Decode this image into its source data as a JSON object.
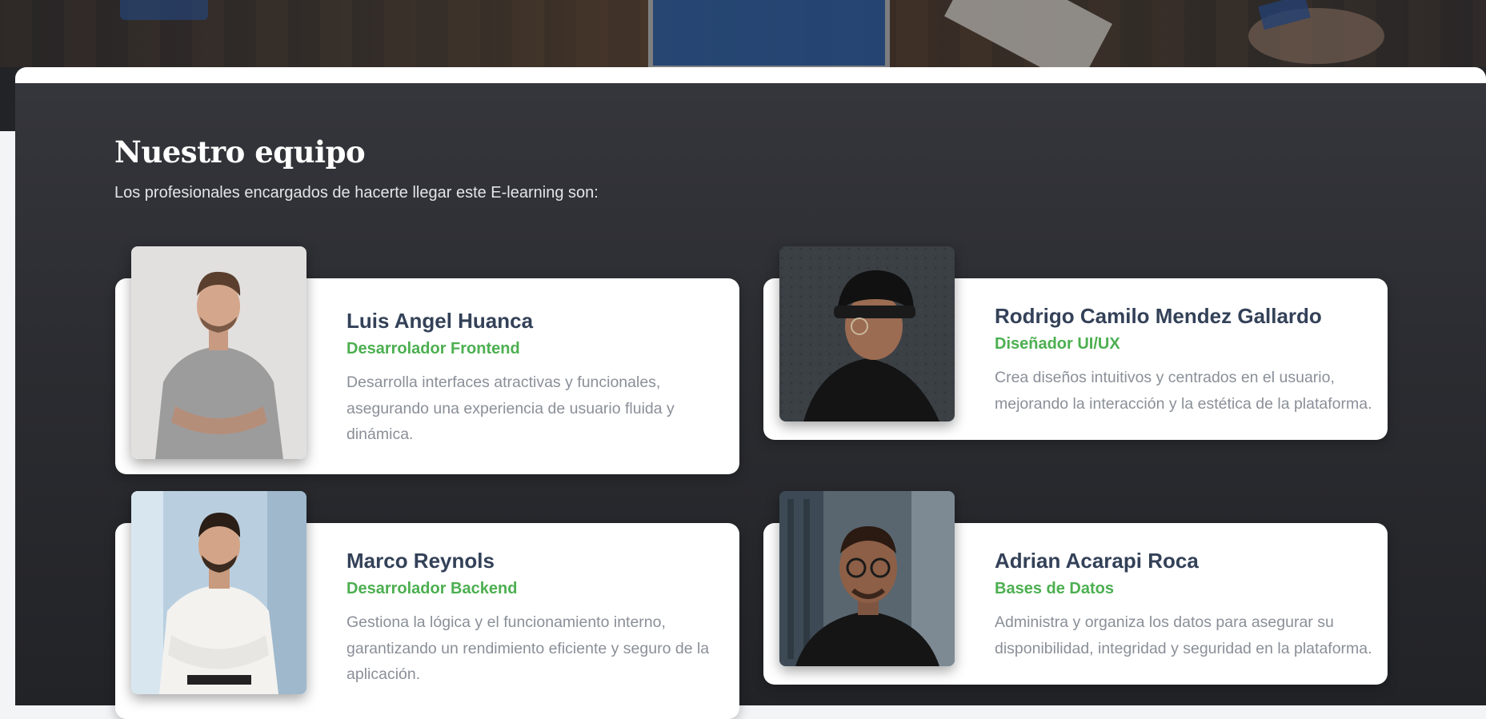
{
  "section": {
    "title": "Nuestro equipo",
    "subtitle": "Los profesionales encargados de hacerte llegar este E-learning son:"
  },
  "members": [
    {
      "name": "Luis Angel Huanca",
      "role": "Desarrolador Frontend",
      "description": "Desarrolla interfaces atractivas y funcionales, asegurando una experiencia de usuario fluida y dinámica."
    },
    {
      "name": "Rodrigo Camilo Mendez Gallardo",
      "role": "Diseñador UI/UX",
      "description": "Crea diseños intuitivos y centrados en el usuario, mejorando la interacción y la estética de la plataforma."
    },
    {
      "name": "Marco Reynols",
      "role": "Desarrolador Backend",
      "description": "Gestiona la lógica y el funcionamiento interno, garantizando un rendimiento eficiente y seguro de la aplicación."
    },
    {
      "name": "Adrian Acarapi Roca",
      "role": "Bases de Datos",
      "description": "Administra y organiza los datos para asegurar su disponibilidad, integridad y seguridad en la plataforma."
    }
  ],
  "colors": {
    "accent_green": "#4caf50",
    "name_color": "#334158",
    "section_background": "#2b2c31"
  }
}
